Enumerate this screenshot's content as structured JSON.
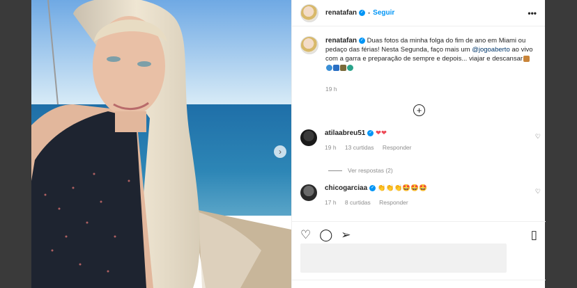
{
  "post": {
    "author": "renatafan",
    "follow_label": "Seguir",
    "separator": "•",
    "more_icon": "more-horizontal-icon",
    "more_label": "•••",
    "caption": {
      "author": "renatafan",
      "text_before_mention": "Duas fotos da minha folga do fim de ano em Miami ou pedaço das férias! Nesta Segunda, faço mais um",
      "mention": "@jogoaberto",
      "text_after_mention": "ao vivo com a garra e preparação de sempre e depois... viajar e descansar",
      "time": "19 h"
    },
    "load_more_label": "+",
    "comments": [
      {
        "user": "atilaabreu51",
        "emoji": "❤❤",
        "time": "19 h",
        "likes": "13 curtidas",
        "reply_label": "Responder",
        "view_replies": "Ver respostas (2)"
      },
      {
        "user": "chicogarciaa",
        "emoji": "👏👏👏🤩🤩🤩",
        "time": "17 h",
        "likes": "8 curtidas",
        "reply_label": "Responder"
      }
    ],
    "actions": {
      "like_icon": "heart-icon",
      "comment_icon": "comment-icon",
      "share_icon": "send-icon",
      "save_icon": "bookmark-icon"
    },
    "carousel_next_label": "›"
  },
  "colors": {
    "link_blue": "#0095f6",
    "mention_blue": "#00376b",
    "text": "#262626",
    "muted": "#8e8e8e",
    "heart_red": "#ed4956"
  }
}
